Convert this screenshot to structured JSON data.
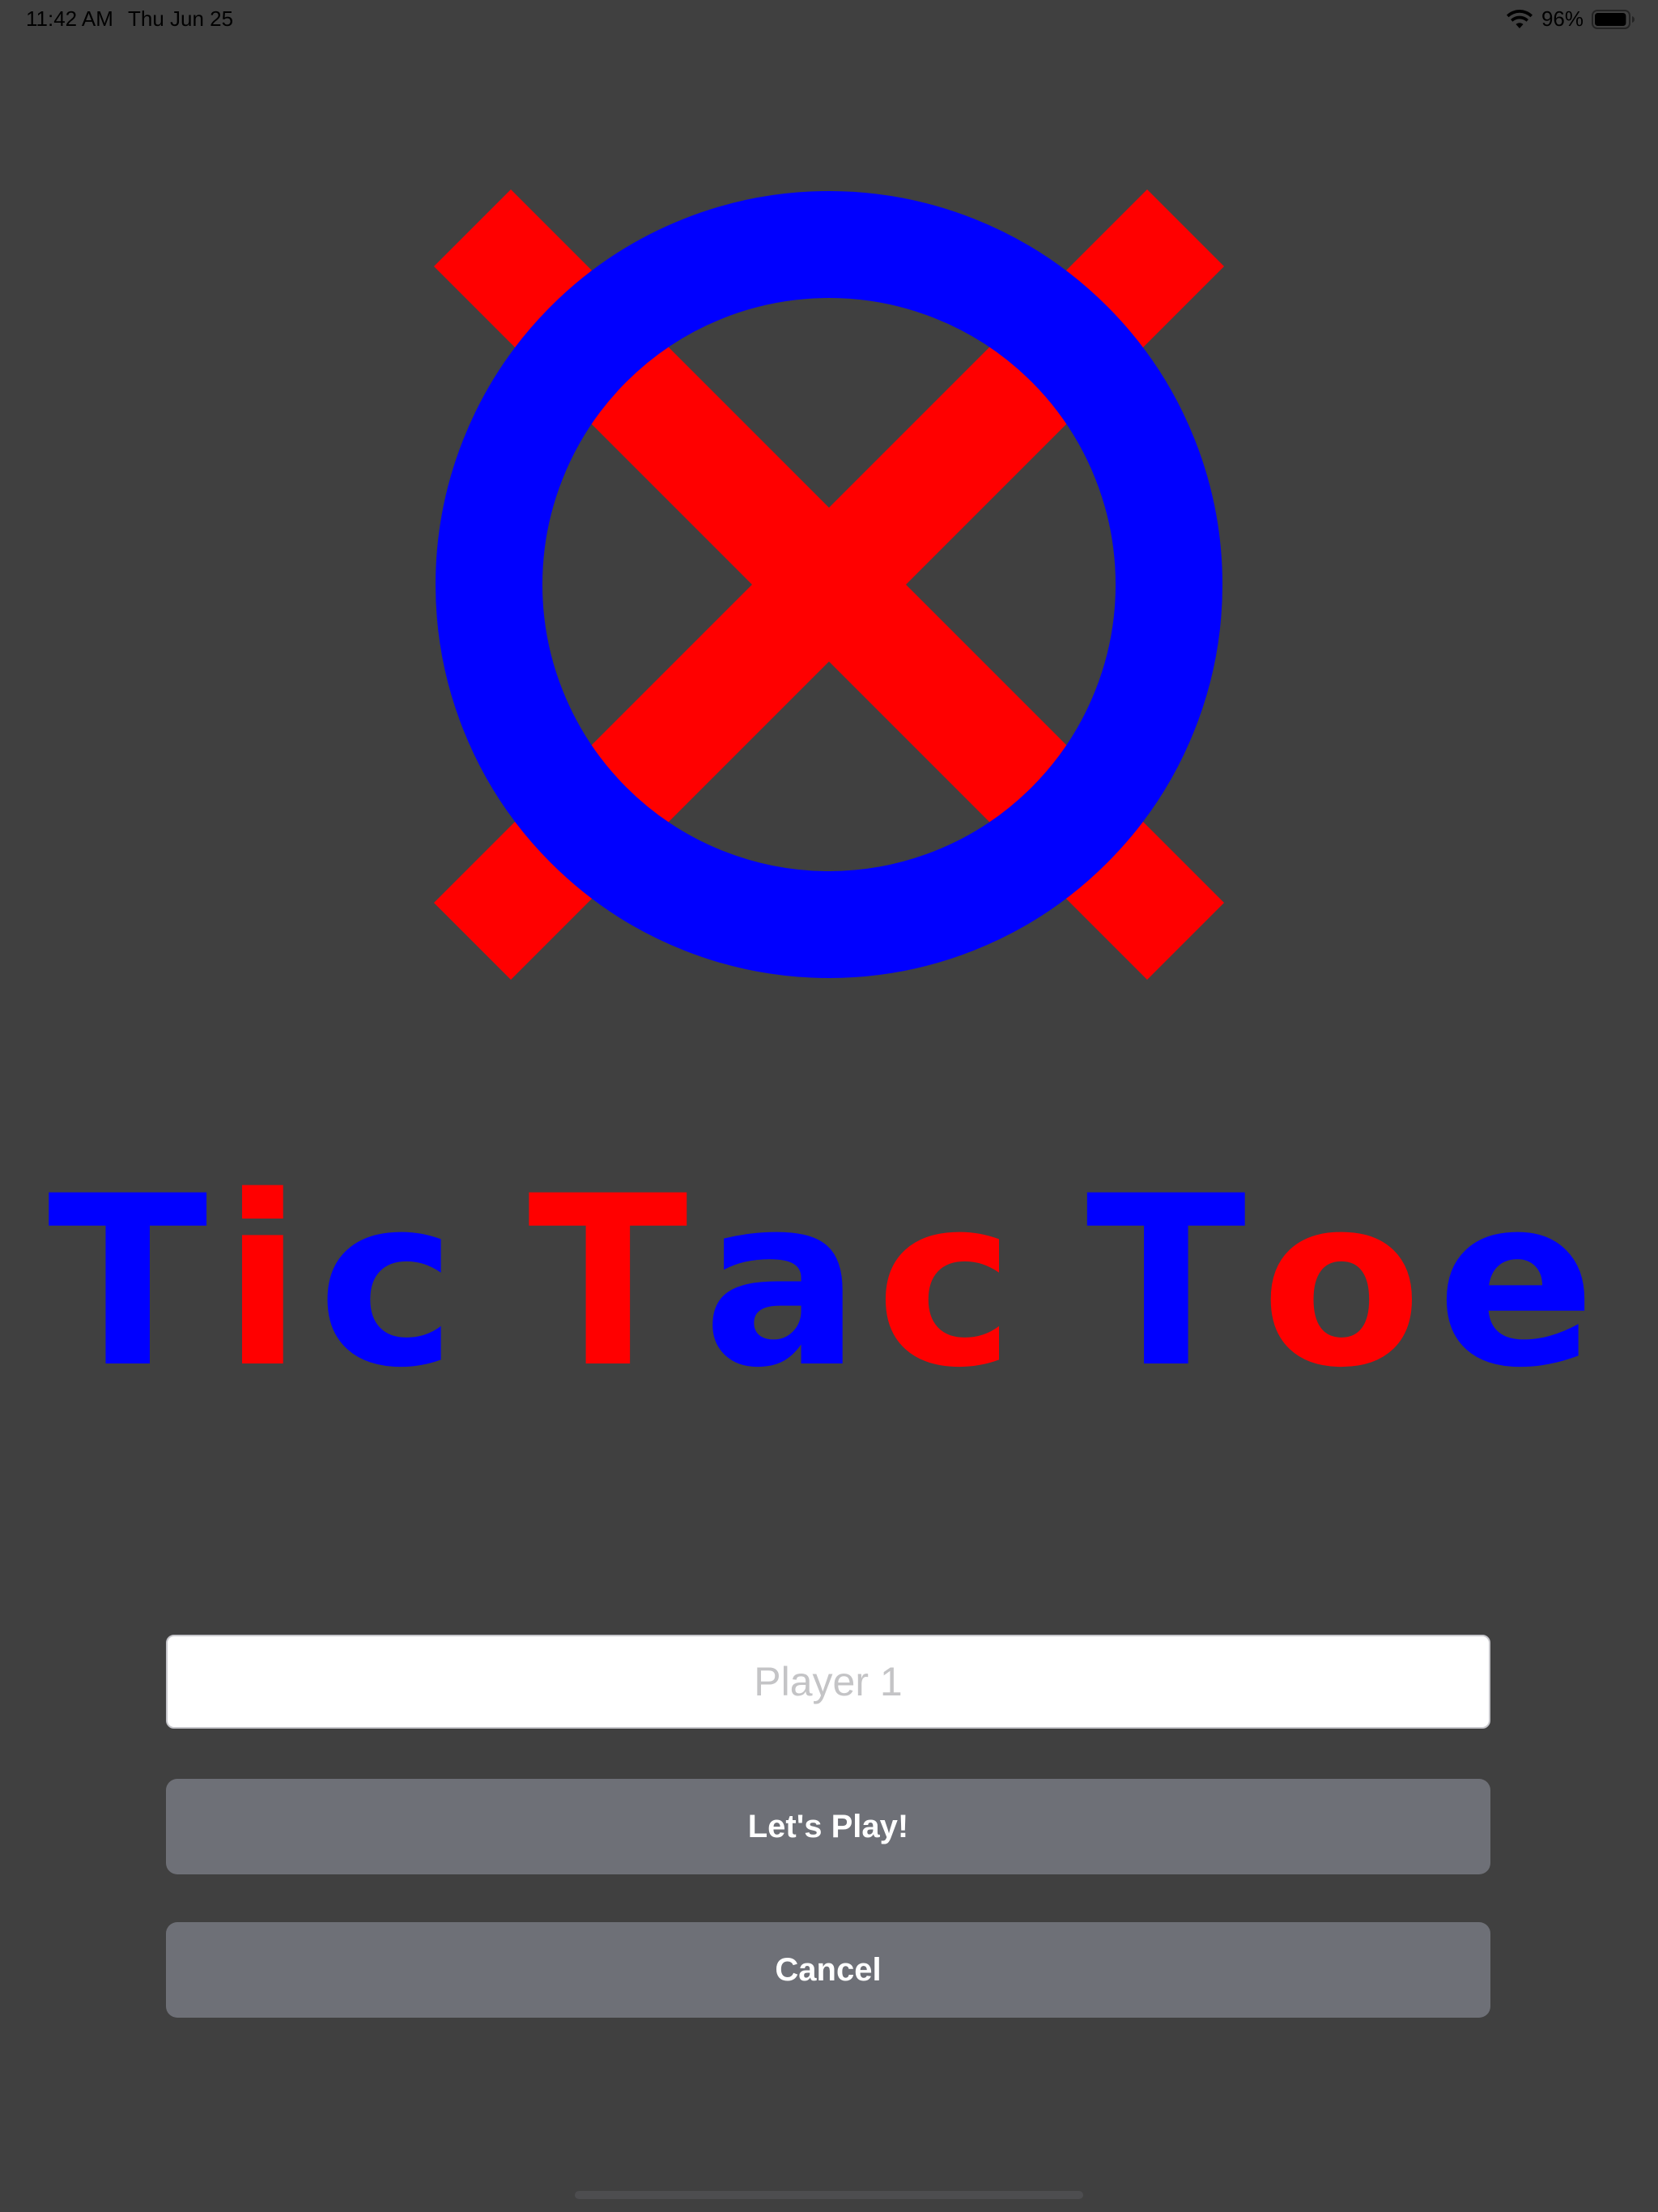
{
  "status_bar": {
    "time": "11:42 AM",
    "date": "Thu Jun 25",
    "battery_percent": "96%",
    "battery_level": 0.96,
    "wifi_icon": "wifi-icon",
    "battery_icon": "battery-icon"
  },
  "logo": {
    "x_color": "#ff0000",
    "o_color": "#0000ff"
  },
  "title": {
    "letters": [
      {
        "char": "T",
        "color": "#0000ff"
      },
      {
        "char": "i",
        "color": "#ff0000"
      },
      {
        "char": "c",
        "color": "#0000ff"
      },
      {
        "char": " ",
        "color": ""
      },
      {
        "char": "T",
        "color": "#ff0000"
      },
      {
        "char": "a",
        "color": "#0000ff"
      },
      {
        "char": "c",
        "color": "#ff0000"
      },
      {
        "char": " ",
        "color": ""
      },
      {
        "char": "T",
        "color": "#0000ff"
      },
      {
        "char": "o",
        "color": "#ff0000"
      },
      {
        "char": "e",
        "color": "#0000ff"
      }
    ]
  },
  "form": {
    "player_placeholder": "Player 1",
    "player_value": "",
    "play_label": "Let's Play!",
    "cancel_label": "Cancel"
  },
  "colors": {
    "background": "#404040",
    "button": "#6e7077",
    "red": "#ff0000",
    "blue": "#0000ff"
  }
}
